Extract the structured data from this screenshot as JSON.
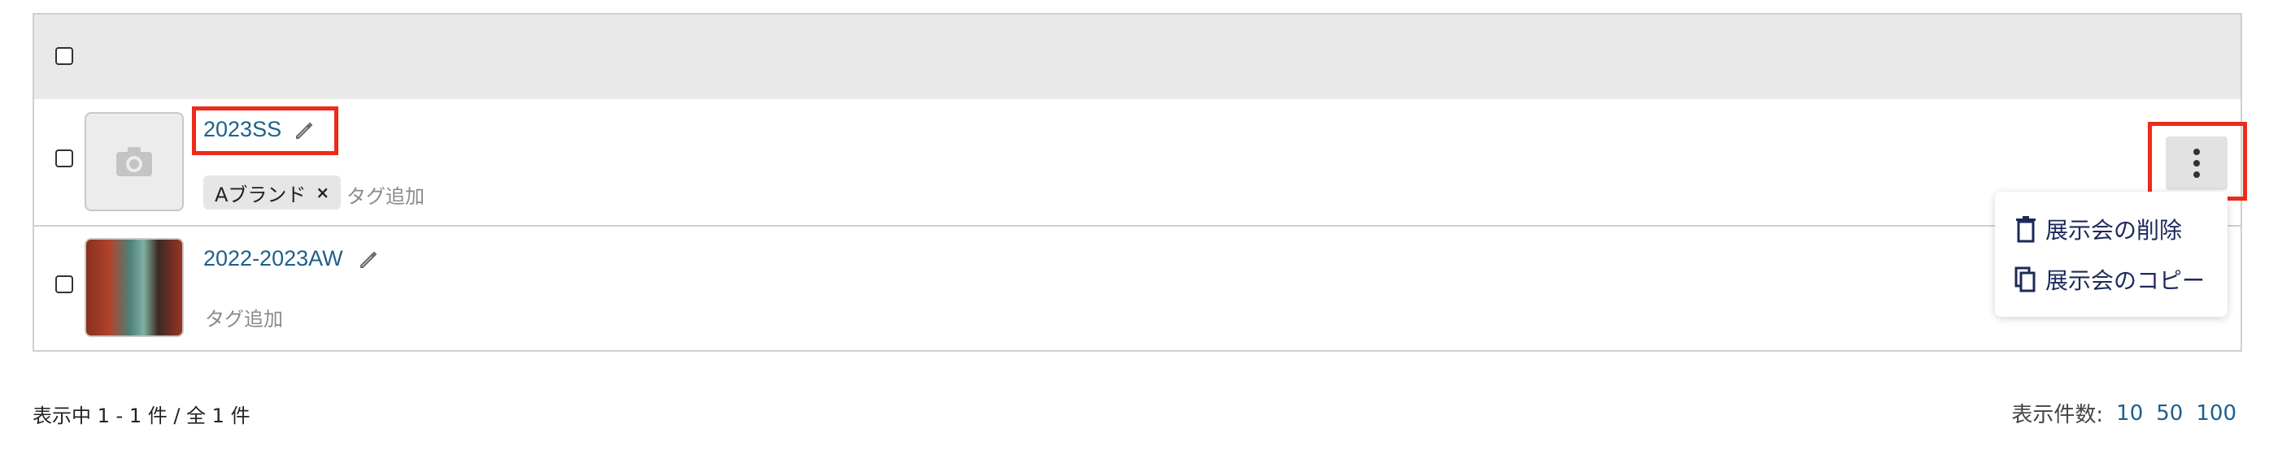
{
  "rows": [
    {
      "title": "2023SS",
      "tag": "Aブランド",
      "tag_remove": "×",
      "add_tag": "タグ追加",
      "thumb_icon": "camera-icon"
    },
    {
      "title": "2022-2023AW",
      "add_tag": "タグ追加",
      "thumb_icon": "photo-thumbnail"
    }
  ],
  "menu": {
    "delete_label": "展示会の削除",
    "copy_label": "展示会のコピー"
  },
  "footer": {
    "count_text": "表示中 1 - 1 件 / 全 1 件",
    "per_page_label": "表示件数:",
    "per_page_options": [
      "10",
      "50",
      "100"
    ]
  },
  "colors": {
    "link": "#1f5f8b",
    "highlight": "#ee2a1b",
    "menu_text": "#1c2a5a",
    "header_bg": "#e9e9e9"
  }
}
